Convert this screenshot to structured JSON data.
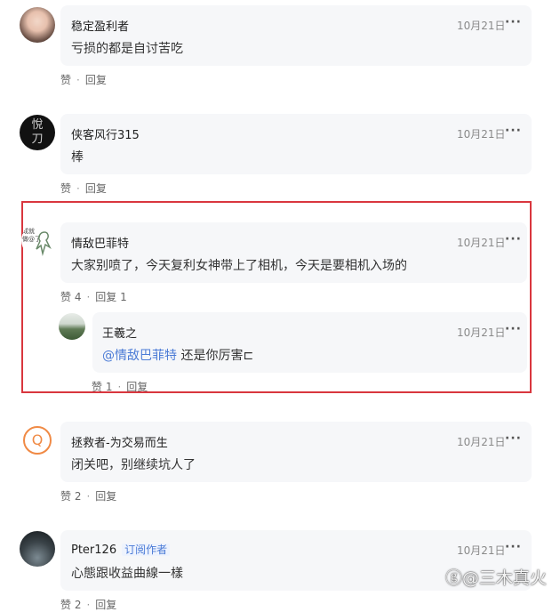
{
  "comments": [
    {
      "username": "稳定盈利者",
      "date": "10月21日",
      "text": "亏损的都是自讨苦吃",
      "like_label": "赞",
      "reply_label": "回复"
    },
    {
      "username": "侠客风行315",
      "date": "10月21日",
      "text": "棒",
      "like_label": "赞",
      "reply_label": "回复"
    },
    {
      "username": "情敌巴菲特",
      "date": "10月21日",
      "text": "大家别喷了，今天复利女神带上了相机，今天是要相机入场的",
      "like_label": "赞 4",
      "reply_label": "回复 1",
      "avatar_text": "成就\n做@了",
      "reply": {
        "username": "王羲之",
        "date": "10月21日",
        "mention": "@情敌巴菲特",
        "text": " 还是你厉害⊏",
        "like_label": "赞 1",
        "reply_label": "回复"
      }
    },
    {
      "username": "拯救者-为交易而生",
      "date": "10月21日",
      "text": "闭关吧，别继续坑人了",
      "like_label": "赞 2",
      "reply_label": "回复",
      "avatar_letter": "Q"
    },
    {
      "username": "Pter126",
      "badge": "订阅作者",
      "date": "10月21日",
      "text": "心態跟收益曲線一樣",
      "like_label": "赞 2",
      "reply_label": "回复"
    }
  ],
  "more_glyph": "···",
  "separator_glyph": "·",
  "avatar2_glyph": "悅\n刀",
  "watermark": "@三木真火",
  "colors": {
    "highlight": "#d9363e",
    "mention": "#4b7bd6"
  }
}
